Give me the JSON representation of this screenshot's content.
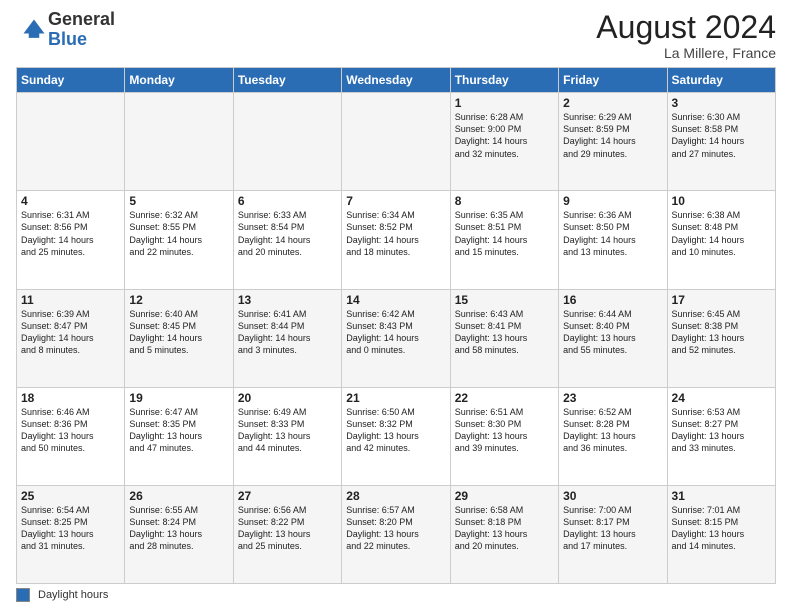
{
  "logo": {
    "general": "General",
    "blue": "Blue"
  },
  "title": {
    "month_year": "August 2024",
    "location": "La Millere, France"
  },
  "header_days": [
    "Sunday",
    "Monday",
    "Tuesday",
    "Wednesday",
    "Thursday",
    "Friday",
    "Saturday"
  ],
  "weeks": [
    [
      {
        "day": "",
        "text": ""
      },
      {
        "day": "",
        "text": ""
      },
      {
        "day": "",
        "text": ""
      },
      {
        "day": "",
        "text": ""
      },
      {
        "day": "1",
        "text": "Sunrise: 6:28 AM\nSunset: 9:00 PM\nDaylight: 14 hours\nand 32 minutes."
      },
      {
        "day": "2",
        "text": "Sunrise: 6:29 AM\nSunset: 8:59 PM\nDaylight: 14 hours\nand 29 minutes."
      },
      {
        "day": "3",
        "text": "Sunrise: 6:30 AM\nSunset: 8:58 PM\nDaylight: 14 hours\nand 27 minutes."
      }
    ],
    [
      {
        "day": "4",
        "text": "Sunrise: 6:31 AM\nSunset: 8:56 PM\nDaylight: 14 hours\nand 25 minutes."
      },
      {
        "day": "5",
        "text": "Sunrise: 6:32 AM\nSunset: 8:55 PM\nDaylight: 14 hours\nand 22 minutes."
      },
      {
        "day": "6",
        "text": "Sunrise: 6:33 AM\nSunset: 8:54 PM\nDaylight: 14 hours\nand 20 minutes."
      },
      {
        "day": "7",
        "text": "Sunrise: 6:34 AM\nSunset: 8:52 PM\nDaylight: 14 hours\nand 18 minutes."
      },
      {
        "day": "8",
        "text": "Sunrise: 6:35 AM\nSunset: 8:51 PM\nDaylight: 14 hours\nand 15 minutes."
      },
      {
        "day": "9",
        "text": "Sunrise: 6:36 AM\nSunset: 8:50 PM\nDaylight: 14 hours\nand 13 minutes."
      },
      {
        "day": "10",
        "text": "Sunrise: 6:38 AM\nSunset: 8:48 PM\nDaylight: 14 hours\nand 10 minutes."
      }
    ],
    [
      {
        "day": "11",
        "text": "Sunrise: 6:39 AM\nSunset: 8:47 PM\nDaylight: 14 hours\nand 8 minutes."
      },
      {
        "day": "12",
        "text": "Sunrise: 6:40 AM\nSunset: 8:45 PM\nDaylight: 14 hours\nand 5 minutes."
      },
      {
        "day": "13",
        "text": "Sunrise: 6:41 AM\nSunset: 8:44 PM\nDaylight: 14 hours\nand 3 minutes."
      },
      {
        "day": "14",
        "text": "Sunrise: 6:42 AM\nSunset: 8:43 PM\nDaylight: 14 hours\nand 0 minutes."
      },
      {
        "day": "15",
        "text": "Sunrise: 6:43 AM\nSunset: 8:41 PM\nDaylight: 13 hours\nand 58 minutes."
      },
      {
        "day": "16",
        "text": "Sunrise: 6:44 AM\nSunset: 8:40 PM\nDaylight: 13 hours\nand 55 minutes."
      },
      {
        "day": "17",
        "text": "Sunrise: 6:45 AM\nSunset: 8:38 PM\nDaylight: 13 hours\nand 52 minutes."
      }
    ],
    [
      {
        "day": "18",
        "text": "Sunrise: 6:46 AM\nSunset: 8:36 PM\nDaylight: 13 hours\nand 50 minutes."
      },
      {
        "day": "19",
        "text": "Sunrise: 6:47 AM\nSunset: 8:35 PM\nDaylight: 13 hours\nand 47 minutes."
      },
      {
        "day": "20",
        "text": "Sunrise: 6:49 AM\nSunset: 8:33 PM\nDaylight: 13 hours\nand 44 minutes."
      },
      {
        "day": "21",
        "text": "Sunrise: 6:50 AM\nSunset: 8:32 PM\nDaylight: 13 hours\nand 42 minutes."
      },
      {
        "day": "22",
        "text": "Sunrise: 6:51 AM\nSunset: 8:30 PM\nDaylight: 13 hours\nand 39 minutes."
      },
      {
        "day": "23",
        "text": "Sunrise: 6:52 AM\nSunset: 8:28 PM\nDaylight: 13 hours\nand 36 minutes."
      },
      {
        "day": "24",
        "text": "Sunrise: 6:53 AM\nSunset: 8:27 PM\nDaylight: 13 hours\nand 33 minutes."
      }
    ],
    [
      {
        "day": "25",
        "text": "Sunrise: 6:54 AM\nSunset: 8:25 PM\nDaylight: 13 hours\nand 31 minutes."
      },
      {
        "day": "26",
        "text": "Sunrise: 6:55 AM\nSunset: 8:24 PM\nDaylight: 13 hours\nand 28 minutes."
      },
      {
        "day": "27",
        "text": "Sunrise: 6:56 AM\nSunset: 8:22 PM\nDaylight: 13 hours\nand 25 minutes."
      },
      {
        "day": "28",
        "text": "Sunrise: 6:57 AM\nSunset: 8:20 PM\nDaylight: 13 hours\nand 22 minutes."
      },
      {
        "day": "29",
        "text": "Sunrise: 6:58 AM\nSunset: 8:18 PM\nDaylight: 13 hours\nand 20 minutes."
      },
      {
        "day": "30",
        "text": "Sunrise: 7:00 AM\nSunset: 8:17 PM\nDaylight: 13 hours\nand 17 minutes."
      },
      {
        "day": "31",
        "text": "Sunrise: 7:01 AM\nSunset: 8:15 PM\nDaylight: 13 hours\nand 14 minutes."
      }
    ]
  ],
  "footer": {
    "legend_label": "Daylight hours"
  }
}
